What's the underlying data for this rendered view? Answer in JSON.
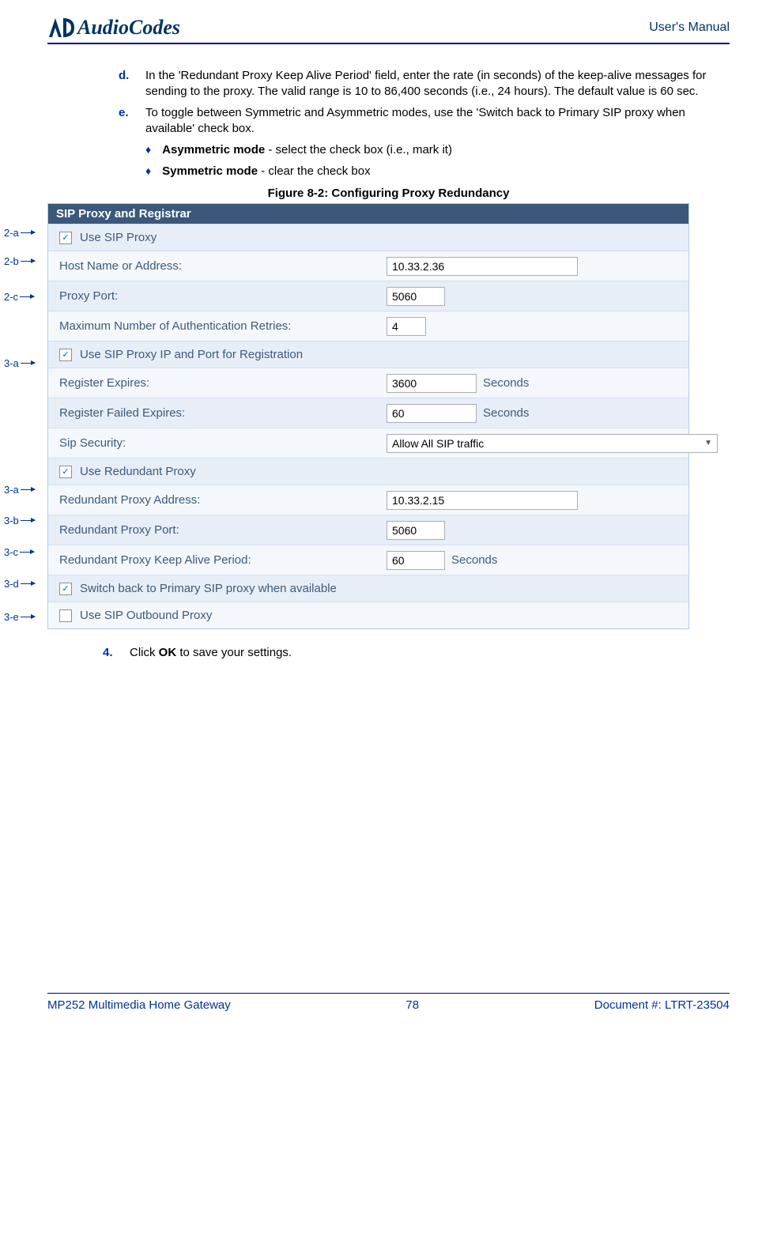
{
  "header": {
    "brand": "AudioCodes",
    "right": "User's Manual"
  },
  "steps": {
    "d_letter": "d.",
    "d_text": "In the 'Redundant Proxy Keep Alive Period' field, enter the rate (in seconds) of the keep-alive messages for sending to the proxy. The valid range is 10 to 86,400 seconds (i.e., 24 hours). The default value is 60 sec.",
    "e_letter": "e.",
    "e_text": "To toggle between Symmetric and Asymmetric modes, use the 'Switch back to Primary SIP proxy when available' check box.",
    "sub1_bold": "Asymmetric mode",
    "sub1_rest": " - select the check box (i.e., mark it)",
    "sub2_bold": "Symmetric mode",
    "sub2_rest": " - clear the check box",
    "step4_num": "4.",
    "step4_pre": "Click ",
    "step4_bold": "OK",
    "step4_post": " to save your settings."
  },
  "figure_caption": "Figure 8-2: Configuring Proxy Redundancy",
  "callouts": {
    "a": "2-a",
    "b": "2-b",
    "c": "2-c",
    "d": "3-a",
    "e": "3-a",
    "f": "3-b",
    "g": "3-c",
    "h": "3-d",
    "i": "3-e"
  },
  "panel": {
    "title": "SIP Proxy and Registrar",
    "use_sip_proxy": "Use SIP Proxy",
    "host_label": "Host Name or Address:",
    "host_value": "10.33.2.36",
    "port_label": "Proxy Port:",
    "port_value": "5060",
    "max_auth_label": "Maximum Number of Authentication Retries:",
    "max_auth_value": "4",
    "use_ip_port_reg": "Use SIP Proxy IP and Port for Registration",
    "reg_expires_label": "Register Expires:",
    "reg_expires_value": "3600",
    "reg_failed_label": "Register Failed Expires:",
    "reg_failed_value": "60",
    "seconds": "Seconds",
    "sip_security_label": "Sip Security:",
    "sip_security_value": "Allow All SIP traffic",
    "use_redundant": "Use Redundant Proxy",
    "red_addr_label": "Redundant Proxy Address:",
    "red_addr_value": "10.33.2.15",
    "red_port_label": "Redundant Proxy Port:",
    "red_port_value": "5060",
    "red_keep_label": "Redundant Proxy Keep Alive Period:",
    "red_keep_value": "60",
    "switch_back": "Switch back to Primary SIP proxy when available",
    "use_outbound": "Use SIP Outbound Proxy"
  },
  "footer": {
    "left": "MP252 Multimedia Home Gateway",
    "center": "78",
    "right": "Document #: LTRT-23504"
  }
}
